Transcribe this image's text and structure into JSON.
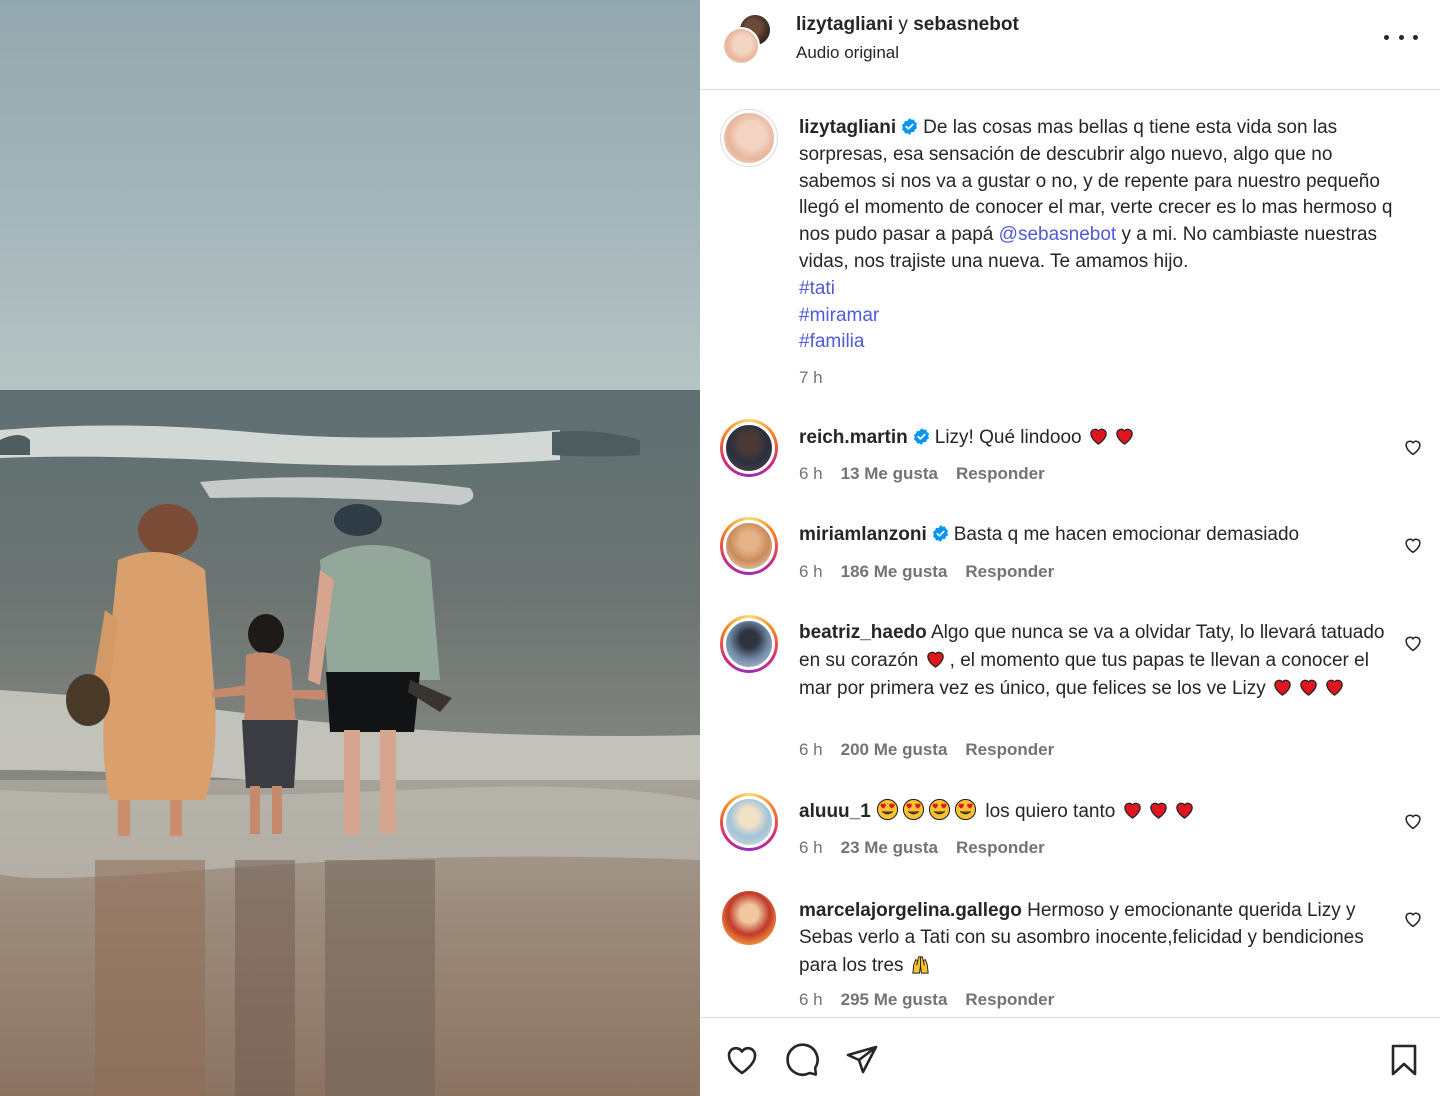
{
  "header": {
    "user1": "lizytagliani",
    "separator": "y",
    "user2": "sebasnebot",
    "audio": "Audio original",
    "more_icon": "more-horizontal-icon"
  },
  "caption": {
    "username": "lizytagliani",
    "text_part1": "De las cosas mas bellas q tiene esta vida son las sorpresas, esa sensación de descubrir algo nuevo, algo que no sabemos si nos va a gustar o no, y de repente para nuestro pequeño llegó el momento de conocer el mar, verte crecer es lo mas hermoso q nos pudo pasar a papá ",
    "mention": "@sebasnebot",
    "text_part2": " y a mi. No cambiaste nuestras vidas, nos trajiste una nueva. Te amamos hijo.",
    "hashtags": [
      "#tati",
      "#miramar",
      "#familia"
    ],
    "time": "7 h"
  },
  "comments": [
    {
      "username": "reich.martin",
      "verified": true,
      "text_before": "Lizy! Qué lindooo",
      "emojis": [
        "red-heart",
        "red-heart"
      ],
      "text_after": "",
      "time": "6 h",
      "likes": "13 Me gusta",
      "reply": "Responder"
    },
    {
      "username": "miriamlanzoni",
      "verified": true,
      "text_before": "Basta q me hacen emocionar demasiado",
      "emojis": [],
      "text_after": "",
      "time": "6 h",
      "likes": "186 Me gusta",
      "reply": "Responder"
    },
    {
      "username": "beatriz_haedo",
      "verified": false,
      "text_before": "Algo que nunca se va a olvidar Taty, lo llevará tatuado en su corazón",
      "emojis": [
        "red-heart"
      ],
      "text_after": ", el momento que tus papas te llevan a conocer el mar por primera vez es único, que felices se los ve Lizy",
      "emojis_end": [
        "red-heart",
        "red-heart",
        "red-heart"
      ],
      "time": "6 h",
      "likes": "200 Me gusta",
      "reply": "Responder"
    },
    {
      "username": "aluuu_1",
      "verified": false,
      "emojis_lead": [
        "heart-eyes",
        "heart-eyes",
        "heart-eyes",
        "heart-eyes"
      ],
      "text_before": "los quiero tanto",
      "emojis": [
        "red-heart",
        "red-heart",
        "red-heart"
      ],
      "text_after": "",
      "time": "6 h",
      "likes": "23 Me gusta",
      "reply": "Responder"
    },
    {
      "username": "marcelajorgelina.gallego",
      "verified": false,
      "text_before": "Hermoso y emocionante querida Lizy y Sebas verlo a Tati con su asombro inocente,felicidad y bendiciones para los tres",
      "emojis": [
        "raised-hands"
      ],
      "text_after": "",
      "time": "6 h",
      "likes": "295 Me gusta",
      "reply": "Responder"
    }
  ],
  "actions": {
    "like_icon": "heart-icon",
    "comment_icon": "comment-icon",
    "share_icon": "share-icon",
    "save_icon": "bookmark-icon"
  },
  "colors": {
    "link": "#4f5bd5",
    "verified": "#0095f6",
    "heart_red": "#ff3040",
    "muted": "#737373",
    "divider": "#dbdbdb"
  }
}
